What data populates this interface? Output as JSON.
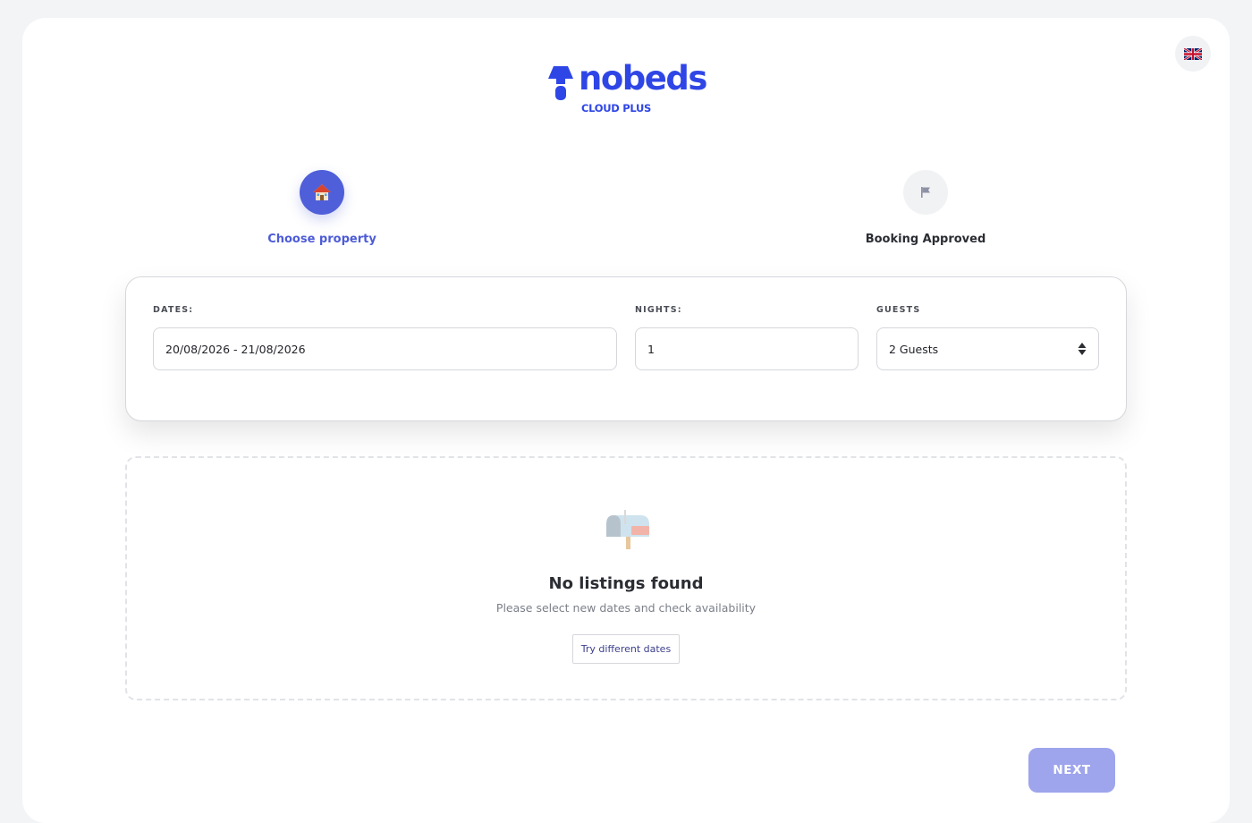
{
  "brand": {
    "name": "nobeds",
    "tagline": "CLOUD PLUS",
    "color": "#2f46e6"
  },
  "language": {
    "icon": "uk-flag-icon"
  },
  "steps": [
    {
      "label": "Choose property",
      "icon": "house-icon",
      "state": "active",
      "color": "#4f5fd9"
    },
    {
      "label": "Booking Approved",
      "icon": "flag-icon",
      "state": "inactive"
    }
  ],
  "search": {
    "dates": {
      "label": "DATES:",
      "value": "20/08/2026 - 21/08/2026"
    },
    "nights": {
      "label": "NIGHTS:",
      "value": "1"
    },
    "guests": {
      "label": "GUESTS",
      "value": "2 Guests",
      "icon": "sort-arrows-icon"
    }
  },
  "empty_state": {
    "icon": "mailbox-icon",
    "title": "No listings found",
    "subtitle": "Please select new dates and check availability",
    "button_label": "Try different dates"
  },
  "footer": {
    "next_label": "NEXT",
    "next_color": "#9ea5ec"
  }
}
